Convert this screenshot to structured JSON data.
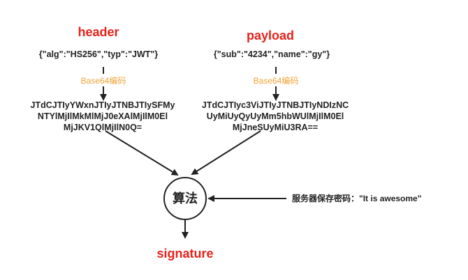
{
  "header": {
    "title": "header",
    "json": "{\"alg\":\"HS256\",\"typ\":\"JWT\"}",
    "encode_label": "Base64编码",
    "encoded_lines": [
      "JTdCJTIyYWxnJTIyJTNBJTIySFMy",
      "NTYlMjIlMkMlMjJ0eXAlMjIlM0El",
      "MjJKV1QlMjIlN0Q="
    ]
  },
  "payload": {
    "title": "payload",
    "json": "{\"sub\":\"4234\",\"name\":\"gy\"}",
    "encode_label": "Base64编码",
    "encoded_lines": [
      "JTdCJTIyc3ViJTIyJTNBJTIyNDIzNC",
      "UyMiUyQyUyMm5hbWUlMjIlM0El",
      "MjJneSUyMiU3RA=="
    ]
  },
  "algorithm": {
    "label": "算法"
  },
  "secret": {
    "label": "服务器保存密码：\"It is awesome\""
  },
  "output": {
    "label": "signature"
  },
  "colors": {
    "title": "#e5231b",
    "encode_label": "#f0a236",
    "line": "#222222"
  }
}
